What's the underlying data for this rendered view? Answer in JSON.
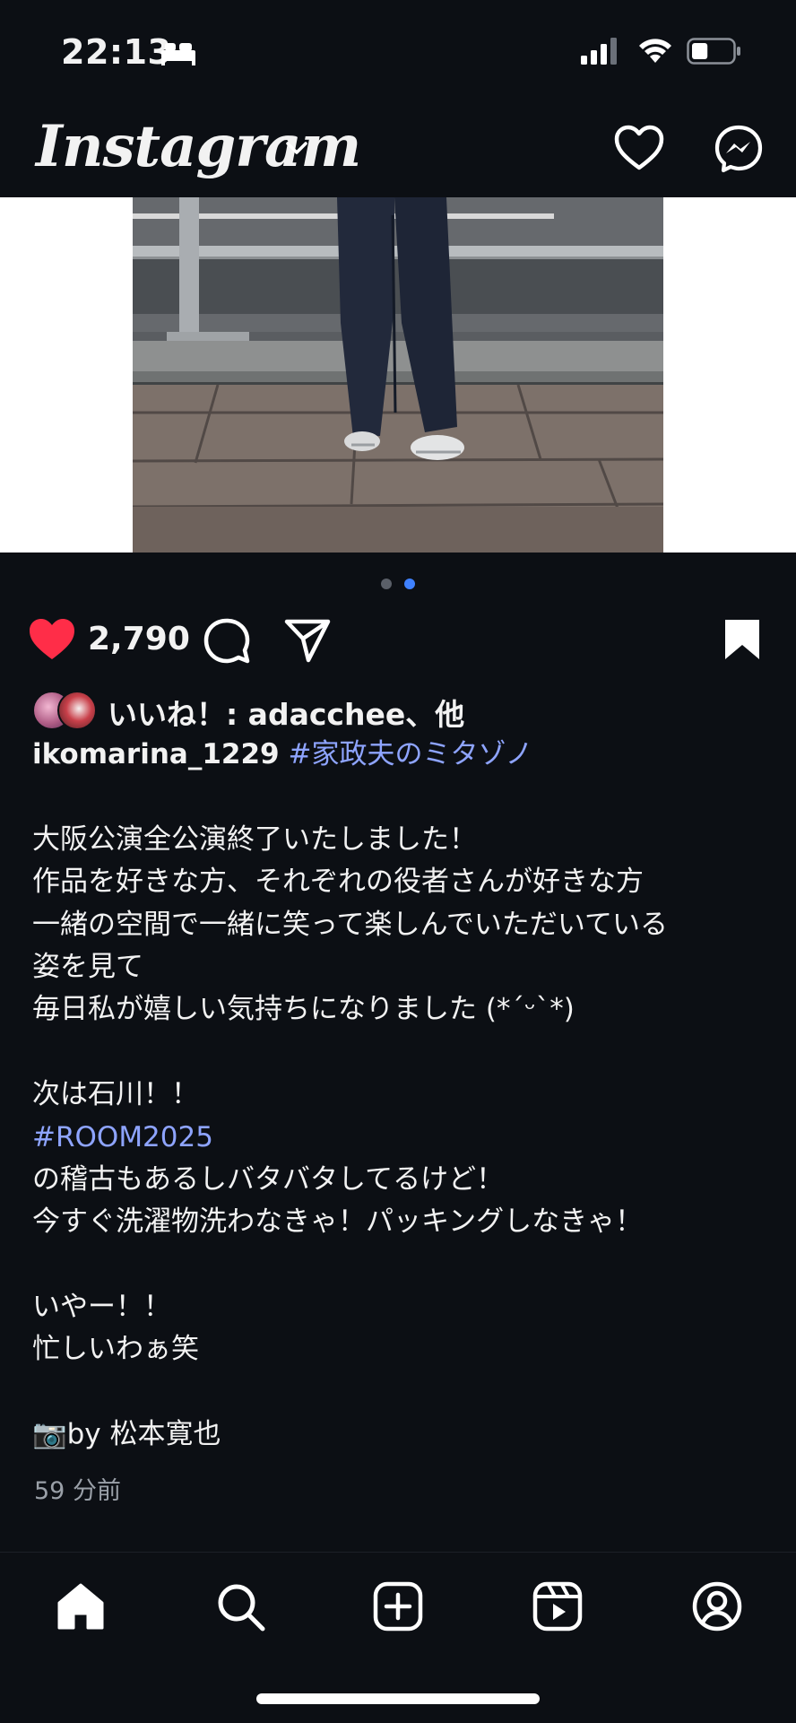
{
  "status_bar": {
    "time": "22:13",
    "sleep_icon": "bed-icon",
    "battery_level": 0.4
  },
  "header": {
    "logo_text": "Instagram",
    "chevron_icon": "chevron-down-icon",
    "notifications_icon": "heart-icon",
    "messages_icon": "messenger-icon"
  },
  "carousel": {
    "total": 2,
    "current": 2
  },
  "actions": {
    "like_count": "2,790",
    "liked": true,
    "like_color": "#ff2d48",
    "saved": true
  },
  "likes": {
    "text": "いいね！: adacchee、他"
  },
  "caption": {
    "username": "ikomarina_1229",
    "hashtag_1": "#家政夫のミタゾノ",
    "line_1": "大阪公演全公演終了いたしました！",
    "line_2": "作品を好きな方、それぞれの役者さんが好きな方",
    "line_3": "一緒の空間で一緒に笑って楽しんでいただいている",
    "line_4": "姿を見て",
    "line_5": "毎日私が嬉しい気持ちになりました (*´ᵕ`*)",
    "line_6": "次は石川！！",
    "hashtag_2": "#ROOM2025",
    "line_7": "の稽古もあるしバタバタしてるけど！",
    "line_8": "今すぐ洗濯物洗わなきゃ！パッキングしなきゃ！",
    "line_9": "いやー！！",
    "line_10": "忙しいわぁ笑",
    "camera_emoji": "📷",
    "line_11": "by 松本寛也",
    "hashtag_color": "#8ea4ff"
  },
  "timestamp": "59 分前",
  "nav": {
    "items": [
      "home-icon",
      "search-icon",
      "create-icon",
      "reels-icon",
      "profile-icon"
    ],
    "active": "home"
  }
}
